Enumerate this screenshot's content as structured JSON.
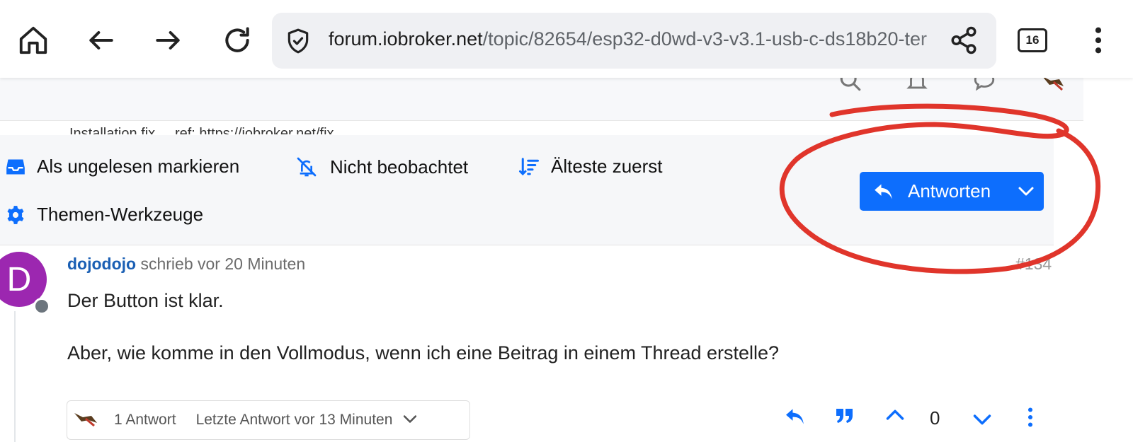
{
  "browser": {
    "url": {
      "host": "forum.iobroker.net",
      "path": "/topic/82654/esp32-d0wd-v3-v3.1-usb-c-ds18b20-ter"
    },
    "tab_count": "16",
    "icons": [
      "home-icon",
      "back-arrow-icon",
      "forward-arrow-icon",
      "reload-icon",
      "shield-icon",
      "share-icon",
      "tabs-icon",
      "more-vert-icon"
    ]
  },
  "forum_header": {
    "icons": [
      "search-icon",
      "bell-icon",
      "chat-icon",
      "user-avatar-icon"
    ],
    "breadcrumb_hint": "Installation fix ... ref: https://iobroker.net/fix ..."
  },
  "topic_tools": {
    "mark_unread": "Als ungelesen markieren",
    "watch_state": "Nicht beobachtet",
    "sort": "Älteste zuerst",
    "tools": "Themen-Werkzeuge",
    "reply_button": "Antworten"
  },
  "post": {
    "avatar_letter": "D",
    "author": "dojodojo",
    "meta": "schrieb vor 20 Minuten",
    "index": "#134",
    "lines": [
      "Der Button ist klar.",
      "Aber, wie komme in den Vollmodus, wenn ich eine Beitrag in einem Thread erstelle?"
    ],
    "replies": {
      "count": "1 Antwort",
      "last": "Letzte Antwort vor 13 Minuten"
    },
    "votes": "0"
  },
  "colors": {
    "accent": "#0d6efd",
    "avatar": "#9c27b0",
    "annotation": "#e0352b"
  }
}
